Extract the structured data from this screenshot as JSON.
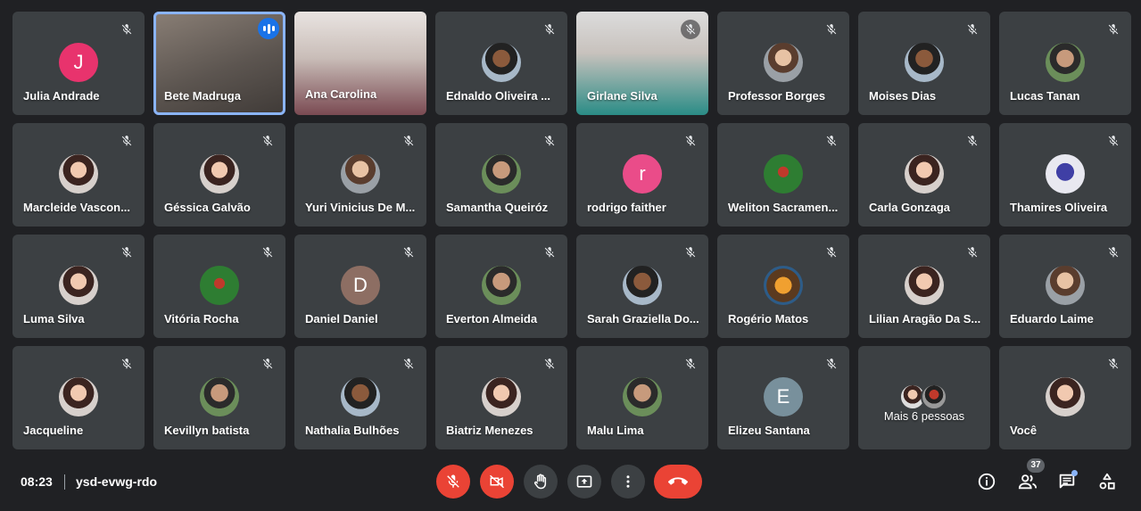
{
  "colors": {
    "background": "#202124",
    "tile": "#3c4043",
    "accent": "#8ab4f8",
    "red": "#ea4335",
    "speaking": "#1a73e8"
  },
  "participants": [
    {
      "name": "Julia Andrade",
      "initial": "J",
      "avatar_color": "#e8336d",
      "muted": true
    },
    {
      "name": "Bete Madruga",
      "video": true,
      "speaking": true
    },
    {
      "name": "Ana Carolina",
      "video": true
    },
    {
      "name": "Ednaldo Oliveira ...",
      "muted": true
    },
    {
      "name": "Girlane Silva",
      "video": true,
      "muted": true
    },
    {
      "name": "Professor Borges",
      "muted": true
    },
    {
      "name": "Moises Dias",
      "muted": true
    },
    {
      "name": "Lucas Tanan",
      "muted": true
    },
    {
      "name": "Marcleide Vascon...",
      "muted": true
    },
    {
      "name": "Géssica Galvão",
      "muted": true
    },
    {
      "name": "Yuri Vinicius De M...",
      "muted": true
    },
    {
      "name": "Samantha Queiróz",
      "muted": true
    },
    {
      "name": "rodrigo faither",
      "initial": "r",
      "avatar_color": "#ea4c89",
      "muted": true
    },
    {
      "name": "Weliton Sacramen...",
      "muted": true
    },
    {
      "name": "Carla Gonzaga",
      "muted": true
    },
    {
      "name": "Thamires Oliveira",
      "muted": true
    },
    {
      "name": "Luma Silva",
      "muted": true
    },
    {
      "name": "Vitória Rocha",
      "muted": true
    },
    {
      "name": "Daniel Daniel",
      "initial": "D",
      "avatar_color": "#8d6e63",
      "muted": true
    },
    {
      "name": "Everton Almeida",
      "muted": true
    },
    {
      "name": "Sarah Graziella Do...",
      "muted": true
    },
    {
      "name": "Rogério Matos",
      "muted": true
    },
    {
      "name": "Lilian Aragão Da S...",
      "muted": true
    },
    {
      "name": "Eduardo Laime",
      "muted": true
    },
    {
      "name": "Jacqueline",
      "muted": true
    },
    {
      "name": "Kevillyn batista",
      "muted": true
    },
    {
      "name": "Nathalia Bulhões",
      "muted": true
    },
    {
      "name": "Biatriz Menezes",
      "muted": true
    },
    {
      "name": "Malu Lima",
      "muted": true
    },
    {
      "name": "Elizeu Santana",
      "initial": "E",
      "avatar_color": "#78909c",
      "muted": true
    },
    {
      "name": "Mais 6 pessoas",
      "more": true
    },
    {
      "name": "Você",
      "muted": true
    }
  ],
  "bottom_bar": {
    "time": "08:23",
    "meeting_code": "ysd-evwg-rdo",
    "participants_count": "37",
    "controls": [
      "mic-off",
      "camera-off",
      "raise-hand",
      "present",
      "more-options",
      "leave-call"
    ],
    "right_controls": [
      "meeting-details",
      "people",
      "chat",
      "activities"
    ]
  }
}
